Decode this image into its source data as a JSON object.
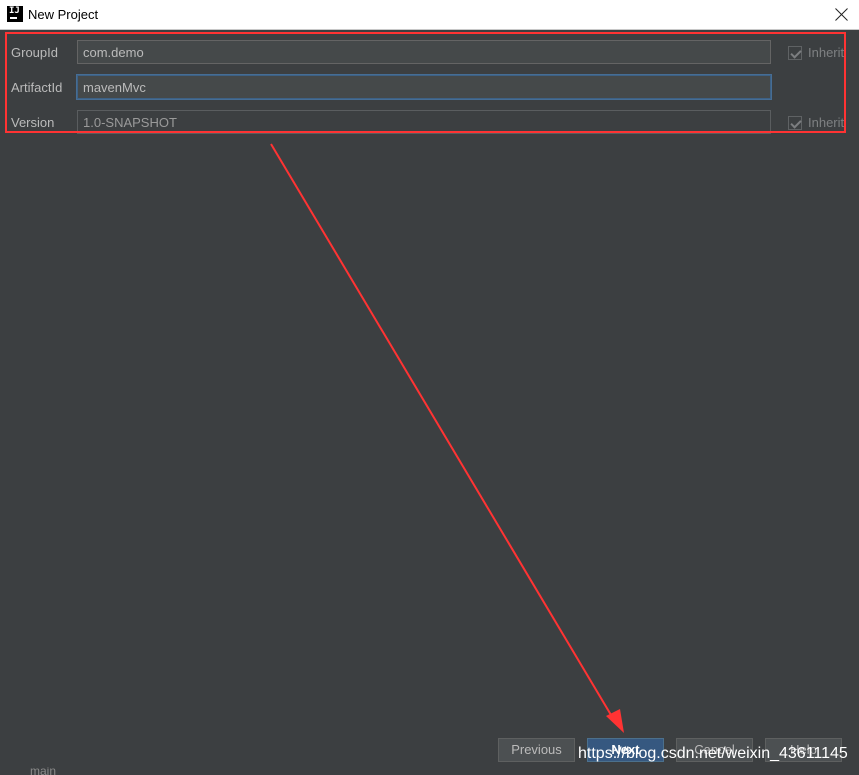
{
  "window": {
    "title": "New Project",
    "logo_text": "IJ"
  },
  "form": {
    "group_id": {
      "label": "GroupId",
      "value": "com.demo",
      "inherit_label": "Inherit",
      "inherit_checked": true
    },
    "artifact_id": {
      "label": "ArtifactId",
      "value": "mavenMvc"
    },
    "version": {
      "label": "Version",
      "value": "1.0-SNAPSHOT",
      "inherit_label": "Inherit",
      "inherit_checked": true
    }
  },
  "buttons": {
    "previous": "Previous",
    "next": "Next",
    "cancel": "Cancel",
    "help": "Help"
  },
  "annotation": {
    "color": "#ff3333"
  },
  "colors": {
    "background": "#3c3f41",
    "input_background": "#45494a",
    "primary_button": "#365880",
    "focus_border": "#3d6185"
  },
  "watermark": "https://blog.csdn.net/weixin_43611145",
  "background_fragment": "main"
}
